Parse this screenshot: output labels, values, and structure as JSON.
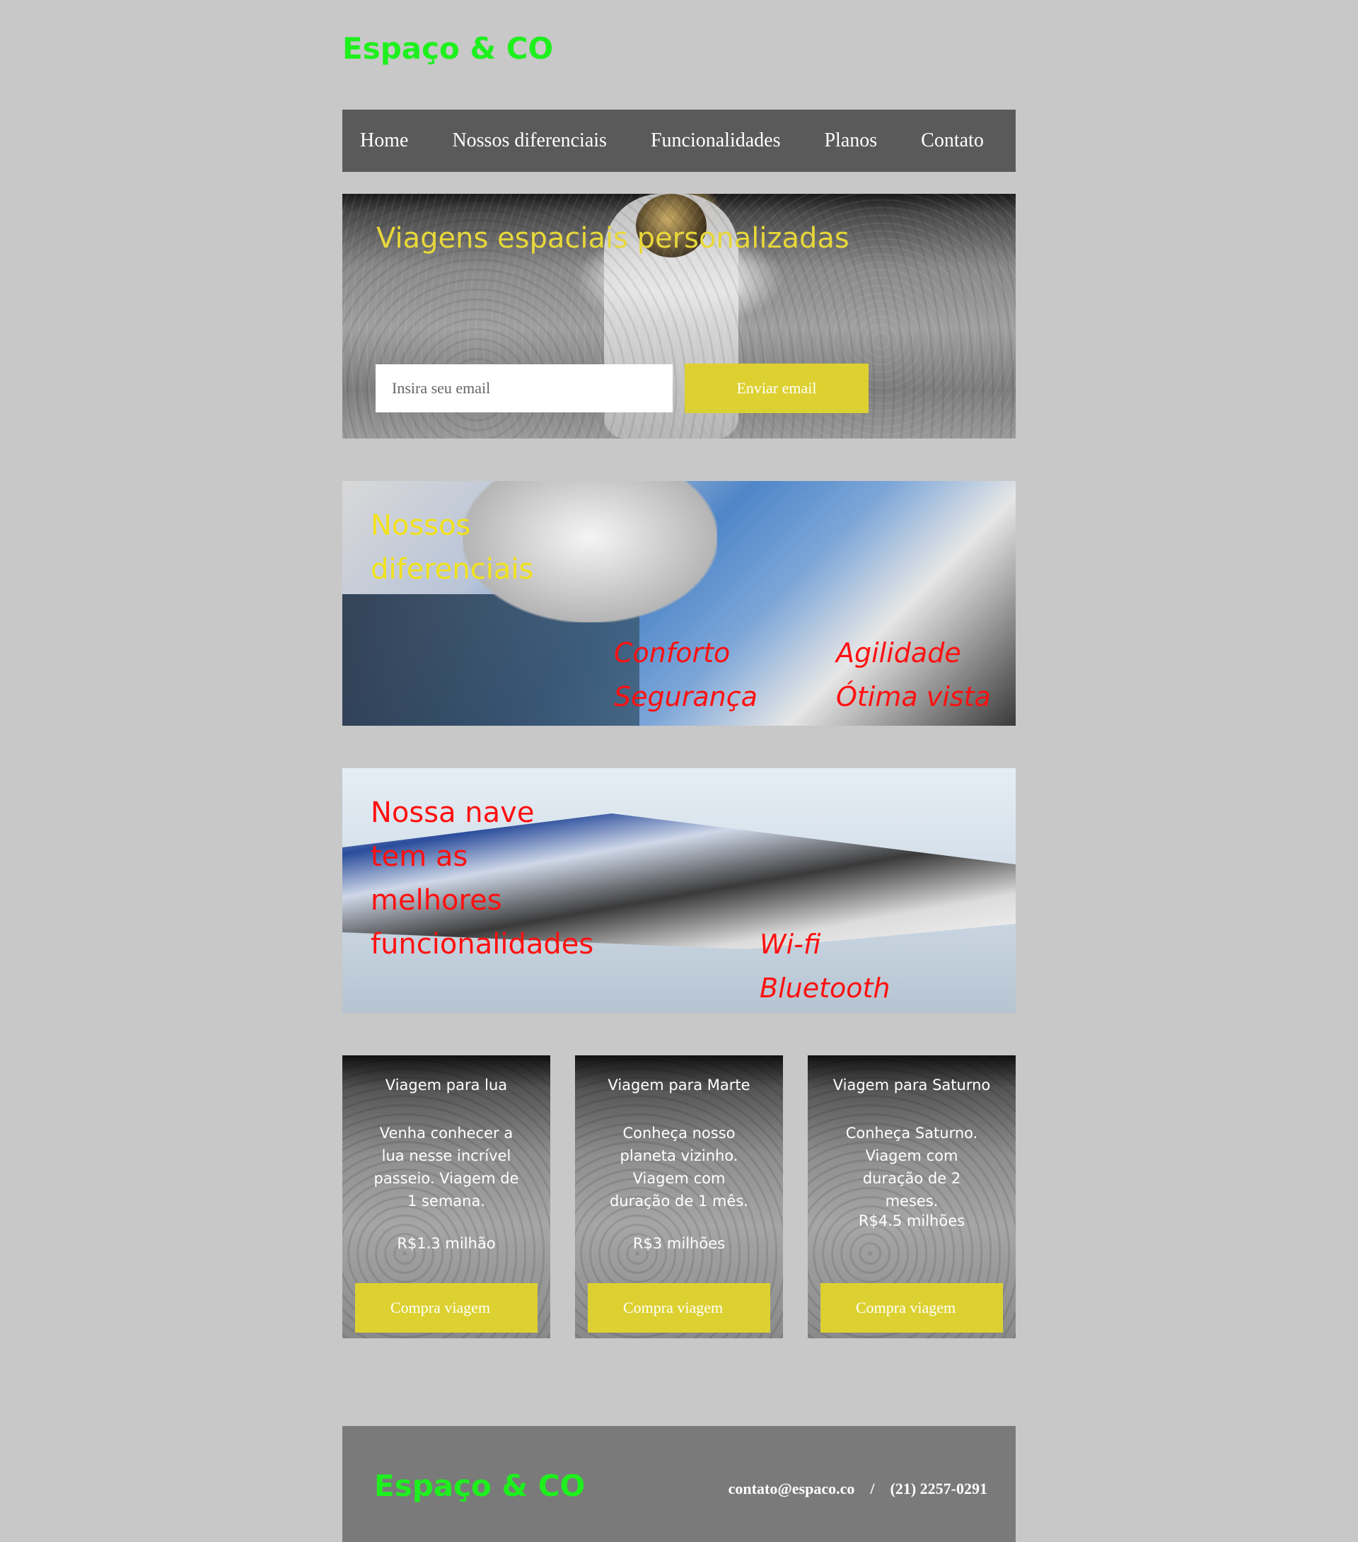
{
  "header": {
    "logo": "Espaço & CO"
  },
  "nav": {
    "items": [
      {
        "label": "Home"
      },
      {
        "label": "Nossos diferenciais"
      },
      {
        "label": "Funcionalidades"
      },
      {
        "label": "Planos"
      },
      {
        "label": "Contato"
      }
    ]
  },
  "hero": {
    "title": "Viagens espaciais personalizadas",
    "email_placeholder": "Insira seu email",
    "send_label": "Enviar email"
  },
  "differentials": {
    "title": "Nossos diferenciais",
    "items": [
      "Conforto",
      "Segurança",
      "Agilidade",
      "Ótima vista"
    ]
  },
  "features": {
    "title": "Nossa nave tem as melhores funcionalidades",
    "items": [
      "Wi-fi",
      "Bluetooth"
    ]
  },
  "plans": [
    {
      "title": "Viagem para lua",
      "description": "Venha conhecer a lua nesse incrível passeio. Viagem  de 1 semana.",
      "price": "R$1.3 milhão",
      "button": "Compra viagem"
    },
    {
      "title": "Viagem para Marte",
      "description": "Conheça nosso planeta vizinho. Viagem com duração de 1 mês.",
      "price": "R$3 milhões",
      "button": "Compra viagem"
    },
    {
      "title": "Viagem para Saturno",
      "description": "Conheça Saturno. Viagem com duração de 2 meses.",
      "price": "R$4.5 milhões",
      "button": "Compra viagem"
    }
  ],
  "footer": {
    "logo": "Espaço & CO",
    "email": "contato@espaco.co",
    "separator": "/",
    "phone": "(21) 2257-0291"
  },
  "colors": {
    "background": "#c8c8c8",
    "logo_green": "#1ef01e",
    "accent_yellow": "#ddd131",
    "nav_bg": "#5a5a5a",
    "footer_bg": "#7a7a7a",
    "feature_red": "#ff1010"
  }
}
